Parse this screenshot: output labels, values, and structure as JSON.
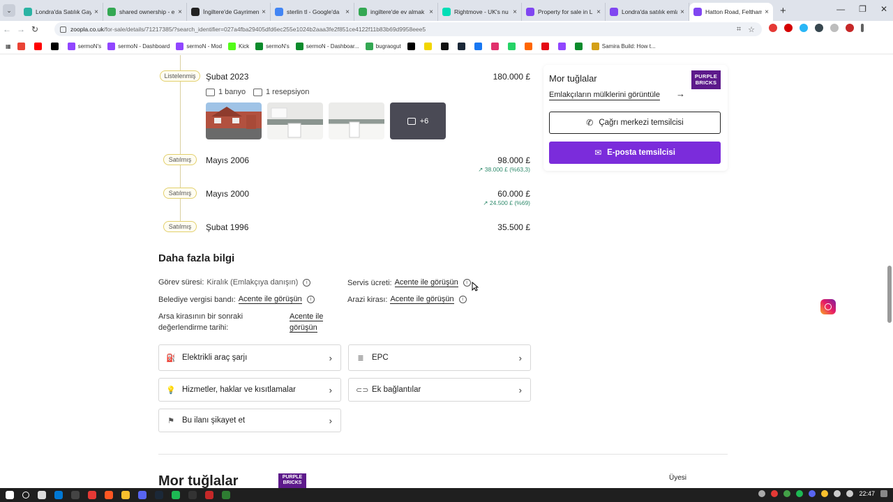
{
  "browser": {
    "tabs": [
      {
        "title": "Londra'da Satılık Gay",
        "color": "#2bb3a3"
      },
      {
        "title": "shared ownership - e",
        "color": "#34a853"
      },
      {
        "title": "İngiltere'de Gayrimen",
        "color": "#222222"
      },
      {
        "title": "sterlin tl - Google'da",
        "color": "#4285f4"
      },
      {
        "title": "ingiltere'de ev almak",
        "color": "#34a853"
      },
      {
        "title": "Rightmove - UK's nu",
        "color": "#00deb6"
      },
      {
        "title": "Property for sale in L",
        "color": "#8046f1"
      },
      {
        "title": "Londra'da satılık emlá",
        "color": "#8046f1"
      },
      {
        "title": "Hatton Road, Feltham",
        "color": "#8046f1",
        "active": true
      }
    ],
    "url_host": "zoopla.co.uk",
    "url_path": "/for-sale/details/71217385/?search_identifier=027a4fba29405dfd6ec255e1024b2aaa3fe2f851ce4122f11b83b69d9958eee5",
    "bookmarks": [
      {
        "label": "",
        "color": "#ea4335"
      },
      {
        "label": "",
        "color": "#ff0000"
      },
      {
        "label": "",
        "color": "#000000"
      },
      {
        "label": "sermoN's",
        "color": "#9146ff"
      },
      {
        "label": "sermoN - Dashboard",
        "color": "#9146ff"
      },
      {
        "label": "sermoN - Mod",
        "color": "#9146ff"
      },
      {
        "label": "Kick",
        "color": "#53fc18"
      },
      {
        "label": "sermoN's",
        "color": "#0b8b2c"
      },
      {
        "label": "sermoN - Dashboar...",
        "color": "#0b8b2c"
      },
      {
        "label": "bugraogut",
        "color": "#34a853"
      },
      {
        "label": "",
        "color": "#000000"
      },
      {
        "label": "",
        "color": "#f2d600"
      },
      {
        "label": "",
        "color": "#111111"
      },
      {
        "label": "",
        "color": "#1b2838"
      },
      {
        "label": "",
        "color": "#1877f2"
      },
      {
        "label": "",
        "color": "#e1306c"
      },
      {
        "label": "",
        "color": "#25d366"
      },
      {
        "label": "",
        "color": "#ff6600"
      },
      {
        "label": "",
        "color": "#e50914"
      },
      {
        "label": "",
        "color": "#9146ff"
      },
      {
        "label": "",
        "color": "#0b8b2c"
      },
      {
        "label": "Samira Build: How t...",
        "color": "#d4a017"
      }
    ]
  },
  "timeline": [
    {
      "badge": "Listelenmiş",
      "date": "Şubat 2023",
      "price": "180.000 £",
      "change": ""
    },
    {
      "badge": "Satılmış",
      "date": "Mayıs 2006",
      "price": "98.000 £",
      "change": "↗ 38.000 £ (%63,3)"
    },
    {
      "badge": "Satılmış",
      "date": "Mayıs 2000",
      "price": "60.000 £",
      "change": "↗ 24.500 £ (%69)"
    },
    {
      "badge": "Satılmış",
      "date": "Şubat 1996",
      "price": "35.500 £",
      "change": ""
    }
  ],
  "listing_features": {
    "bath": "1 banyo",
    "reception": "1 resepsiyon"
  },
  "gallery_more": "+6",
  "agent": {
    "name": "Mor tuğlalar",
    "logo": "PURPLE BRICKS",
    "view_link": "Emlakçıların mülklerini görüntüle",
    "call_button": "Çağrı merkezi temsilcisi",
    "email_button": "E-posta temsilcisi"
  },
  "more_info": {
    "title": "Daha fazla bilgi",
    "tenure_label": "Görev süresi:",
    "tenure_value": "Kiralık (Emlakçıya danışın)",
    "service_label": "Servis ücreti:",
    "service_value": "Acente ile görüşün",
    "council_label": "Belediye vergisi bandı:",
    "council_value": "Acente ile görüşün",
    "ground_label": "Arazi kirası:",
    "ground_value": "Acente ile görüşün",
    "review_label_1": "Arsa kirasının bir sonraki",
    "review_label_2": "değerlendirme tarihi:",
    "review_value_1": "Acente ile",
    "review_value_2": "görüşün"
  },
  "accordions": {
    "ev_charging": "Elektrikli araç şarjı",
    "epc": "EPC",
    "utilities": "Hizmetler, haklar ve kısıtlamalar",
    "links": "Ek bağlantılar",
    "report": "Bu ilanı şikayet et"
  },
  "bottom": {
    "agent_name": "Mor tuğlalar",
    "logo": "PURPLE BRICKS",
    "member": "Üyesi"
  },
  "taskbar": {
    "time": "22:47"
  },
  "colors": {
    "accent": "#7b2cdb",
    "brand": "#5d1a8b",
    "positive": "#2e8a6b",
    "badge_border": "#e2cf6b"
  }
}
